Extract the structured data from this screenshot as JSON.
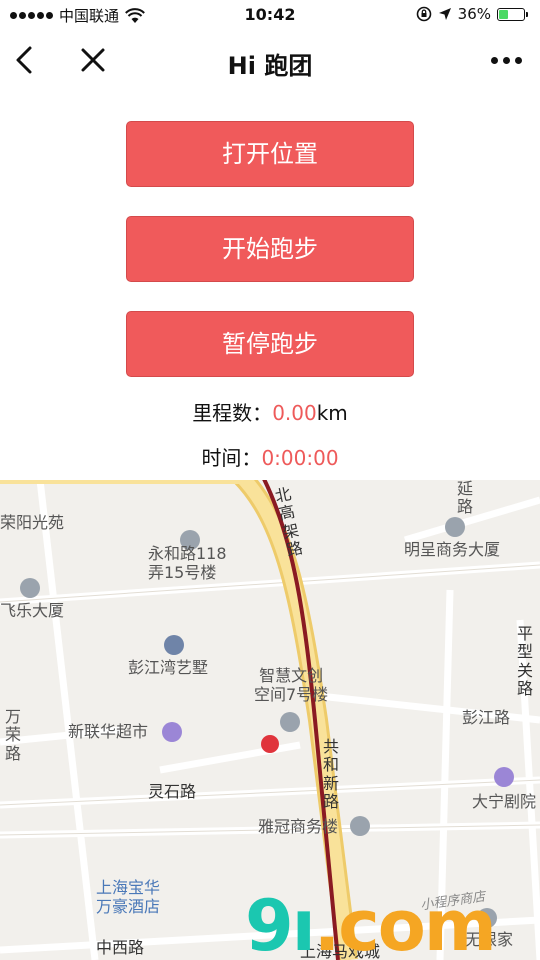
{
  "status_bar": {
    "carrier": "中国联通",
    "time": "10:42",
    "battery_percent": "36%",
    "battery_level": 0.36
  },
  "nav": {
    "title": "Hi 跑团"
  },
  "buttons": {
    "open_location": "打开位置",
    "start_run": "开始跑步",
    "pause_run": "暂停跑步"
  },
  "stats": {
    "distance_label": "里程数：",
    "distance_value": "0.00",
    "distance_unit": "km",
    "time_label": "时间：",
    "time_value": "0:00:00"
  },
  "map": {
    "labels": {
      "rongyang": "荣阳光苑",
      "yonghe": "永和路118\n弄15号楼",
      "feile": "飞乐大厦",
      "pengjiang_villa": "彭江湾艺墅",
      "wanrong_road": "万荣路",
      "xinlianhua": "新联华超市",
      "zhihui": "智慧文创\n空间7号楼",
      "lingshi_road": "灵石路",
      "gonghe_road": "共和新路",
      "north_elevated": "北高架路",
      "mingcheng": "明呈商务大厦",
      "yan_road": "延路",
      "pingxing_road": "平型关路",
      "pengjiang_road": "彭江路",
      "daning_theater": "大宁剧院",
      "yaguan": "雅冠商务楼",
      "baohua": "上海宝华\n万豪酒店",
      "zhongxi_road": "中西路",
      "malls": "上海马戏城",
      "home": "无限家"
    },
    "watermark": "9ı",
    "watermark_dot": ".com",
    "watermark_sub": "小程序商店",
    "colors": {
      "background": "#f2f0ec",
      "main_road": "#f7d77b",
      "route": "#8a1a22",
      "location_dot": "#e0343c"
    }
  },
  "colors": {
    "button_bg": "#f05a5b",
    "accent_text": "#ee5a5a"
  },
  "icons": {
    "back": "chevron-left-icon",
    "close": "close-icon",
    "more": "more-icon",
    "wifi": "wifi-icon",
    "location_arrow": "location-arrow-icon"
  }
}
